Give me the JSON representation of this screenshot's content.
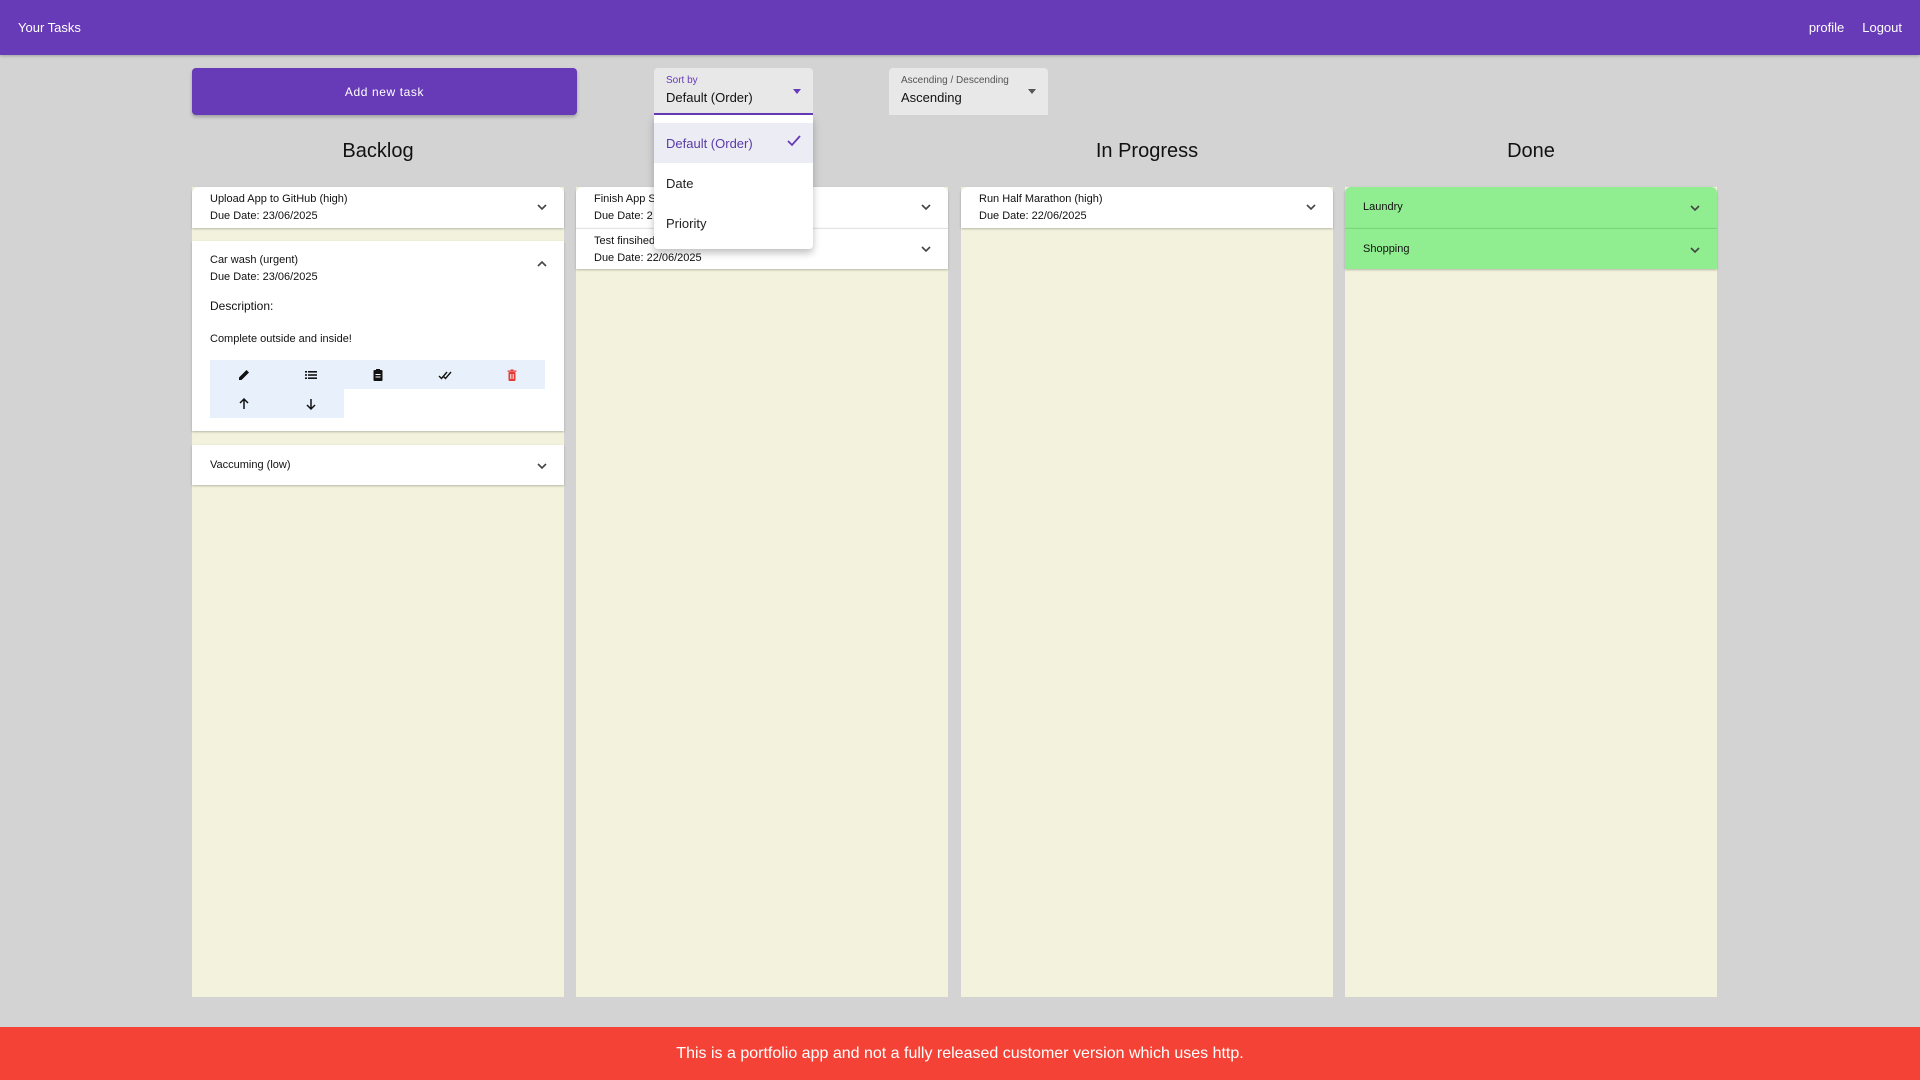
{
  "appbar": {
    "title": "Your Tasks",
    "profile": "profile",
    "logout": "Logout"
  },
  "toolbar": {
    "add_task": "Add new task",
    "sort_by_label": "Sort by",
    "sort_by_value": "Default (Order)",
    "order_label": "Ascending / Descending",
    "order_value": "Ascending"
  },
  "sort_menu": {
    "options": [
      "Default (Order)",
      "Date",
      "Priority"
    ],
    "selected": "Default (Order)"
  },
  "columns": [
    {
      "title": "Backlog"
    },
    {
      "title": ""
    },
    {
      "title": "In Progress"
    },
    {
      "title": "Done"
    }
  ],
  "backlog": {
    "card1": {
      "title": "Upload App to GitHub (high)",
      "due": "Due Date: 23/06/2025"
    },
    "card2": {
      "title": "Car wash (urgent)",
      "due": "Due Date: 23/06/2025",
      "desc_label": "Description:",
      "desc_text": "Complete outside and inside!"
    },
    "card3": {
      "title": "Vaccuming (low)"
    }
  },
  "todo": {
    "card1": {
      "title": "Finish App S",
      "due": "Due Date: 2"
    },
    "card2": {
      "title": "Test finsihed",
      "due": "Due Date: 22/06/2025"
    }
  },
  "inprogress": {
    "card1": {
      "title": "Run Half Marathon (high)",
      "due": "Due Date: 22/06/2025"
    }
  },
  "done": {
    "card1": {
      "title": "Laundry"
    },
    "card2": {
      "title": "Shopping"
    }
  },
  "colors": {
    "primary": "#673ab7",
    "background": "#d3d3d3",
    "column": "#f3f3dd",
    "done_card": "#90ee90",
    "footer": "#f44336",
    "action_bg": "#e8f1fb",
    "delete_icon": "#e53935"
  },
  "icons": {
    "actions": [
      "edit-icon",
      "list-icon",
      "clipboard-icon",
      "done-all-icon",
      "delete-icon",
      "arrow-up-icon",
      "arrow-down-icon"
    ],
    "expand": "chevron-down-icon",
    "collapse": "chevron-up-icon",
    "check": "check-icon"
  },
  "footer": {
    "text": "This is a portfolio app and not a fully released customer version which uses http."
  }
}
